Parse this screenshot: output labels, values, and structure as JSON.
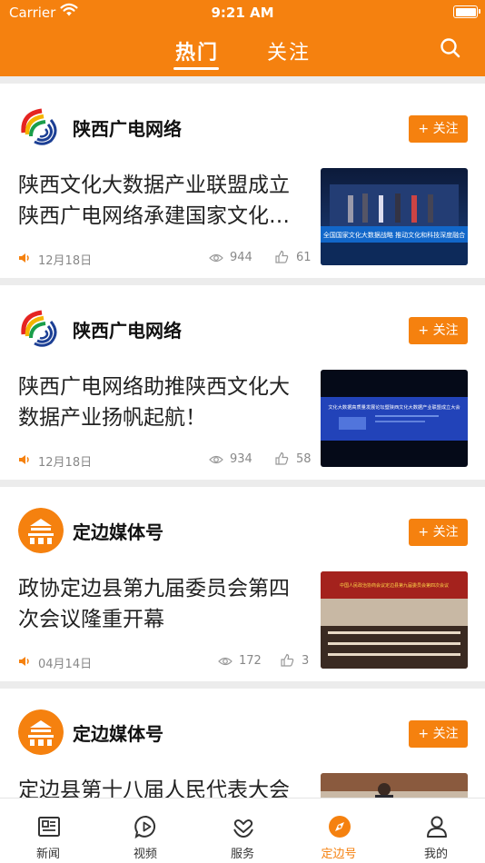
{
  "status_bar": {
    "carrier": "Carrier",
    "time": "9:21 AM"
  },
  "top_tabs": {
    "hot": "热门",
    "follow": "关注"
  },
  "feed": [
    {
      "source": "陕西广电网络",
      "follow_label": "+ 关注",
      "headline": "陕西文化大数据产业联盟成立 陕西广电网络承建国家文化…",
      "date": "12月18日",
      "views": "944",
      "likes": "61",
      "thumb_caption": "全国国家文化大数据战略 推动文化和科技深度融合"
    },
    {
      "source": "陕西广电网络",
      "follow_label": "+ 关注",
      "headline": "陕西广电网络助推陕西文化大数据产业扬帆起航！",
      "date": "12月18日",
      "views": "934",
      "likes": "58",
      "thumb_caption": "文化大数据高质量发展论坛暨陕西文化大数据产业联盟成立大会"
    },
    {
      "source": "定边媒体号",
      "follow_label": "+ 关注",
      "headline": "政协定边县第九届委员会第四次会议隆重开幕",
      "date": "04月14日",
      "views": "172",
      "likes": "3",
      "thumb_caption": "中国人民政治协商会议定边县第九届委员会第四次会议"
    },
    {
      "source": "定边媒体号",
      "follow_label": "+ 关注",
      "headline": "定边县第十八届人民代表大会"
    }
  ],
  "tabbar": [
    {
      "label": "新闻",
      "icon": "news-icon"
    },
    {
      "label": "视频",
      "icon": "video-icon"
    },
    {
      "label": "服务",
      "icon": "service-icon"
    },
    {
      "label": "定边号",
      "icon": "compass-icon",
      "active": true
    },
    {
      "label": "我的",
      "icon": "profile-icon"
    }
  ],
  "colors": {
    "accent": "#f5810f",
    "background": "#ececec"
  }
}
